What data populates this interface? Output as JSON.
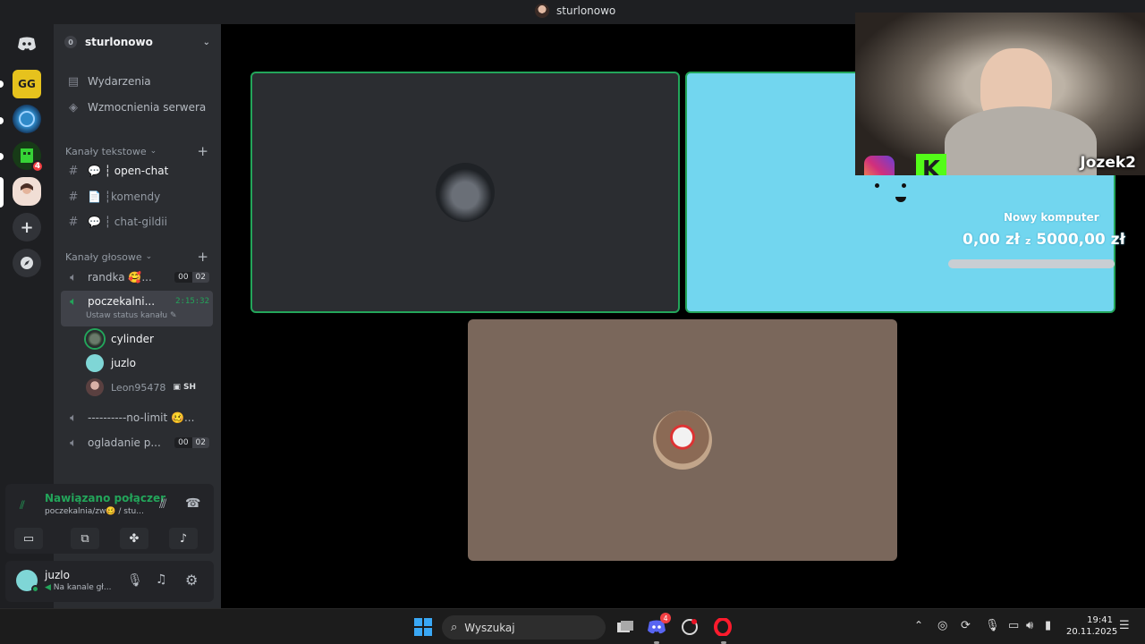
{
  "window": {
    "title": "sturlonowo"
  },
  "server": {
    "name": "sturlonowo",
    "items": [
      "Wydarzenia",
      "Wzmocnienia serwera"
    ]
  },
  "text_category": "Kanały tekstowe",
  "text_channels": [
    {
      "name": "💬 ┆ open-chat",
      "active": true
    },
    {
      "name": "📄 ┆komendy",
      "active": false
    },
    {
      "name": "💬 ┆ chat-gildii",
      "active": false
    }
  ],
  "voice_category": "Kanały głosowe",
  "voice_channels": {
    "randka": {
      "name": "randka 🥰...",
      "count_a": "00",
      "count_b": "02"
    },
    "active": {
      "name": "poczekalni...",
      "timer": "2:15:32",
      "status": "Ustaw status kanału"
    },
    "members": [
      "cylinder",
      "juzlo",
      "Leon95478"
    ],
    "member_tag": "SH",
    "no_limit": {
      "name": "----------no-limit 🥴..."
    },
    "ogladanie": {
      "name": "ogladanie p...",
      "count_a": "00",
      "count_b": "02"
    }
  },
  "voice_panel": {
    "status": "Nawiązano połączer",
    "channel": "poczekalnia/zw🥴 / stu..."
  },
  "user": {
    "name": "juzlo",
    "status": "Na kanale gł..."
  },
  "overlay": {
    "webcam_name": "Jozek2",
    "goal_title": "Nowy komputer",
    "goal_current": "0,00 zł",
    "goal_sep": "z",
    "goal_target": "5000,00 zł",
    "goal_progress": 0
  },
  "taskbar": {
    "search_placeholder": "Wyszukaj",
    "discord_badge": "4",
    "time": "19:41",
    "date": "20.11.2025"
  },
  "colors": {
    "accent_green": "#23a55a",
    "discord_blurple": "#5865f2",
    "tile_cyan": "#72d6ef",
    "tile_brown": "#7a675b",
    "tile_dark": "#2b2d31"
  }
}
